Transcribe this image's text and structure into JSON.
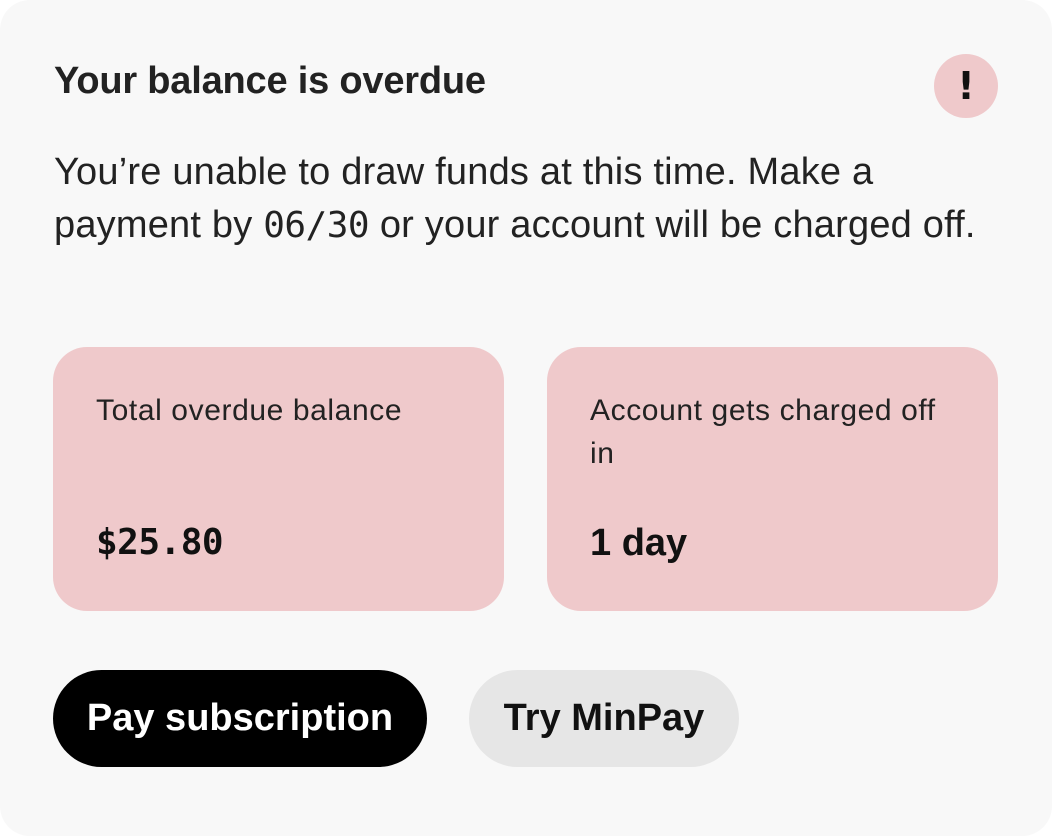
{
  "header": {
    "title": "Your balance is overdue",
    "alert_icon": "exclamation-icon",
    "alert_glyph": "!"
  },
  "message": {
    "before_date": "You’re unable to draw funds at this time. Make a payment by ",
    "date": "06/30",
    "after_date": " or your account will be charged off."
  },
  "tiles": [
    {
      "label": "Total overdue balance",
      "value": "$25.80"
    },
    {
      "label": "Account gets charged off in",
      "value": "1 day"
    }
  ],
  "actions": {
    "primary_label": "Pay subscription",
    "secondary_label": "Try MinPay"
  },
  "colors": {
    "card_background": "#f8f8f8",
    "tile_background": "#efc9cb",
    "alert_background": "#efc9cb",
    "primary_button": "#000000",
    "secondary_button": "#e6e6e6"
  }
}
